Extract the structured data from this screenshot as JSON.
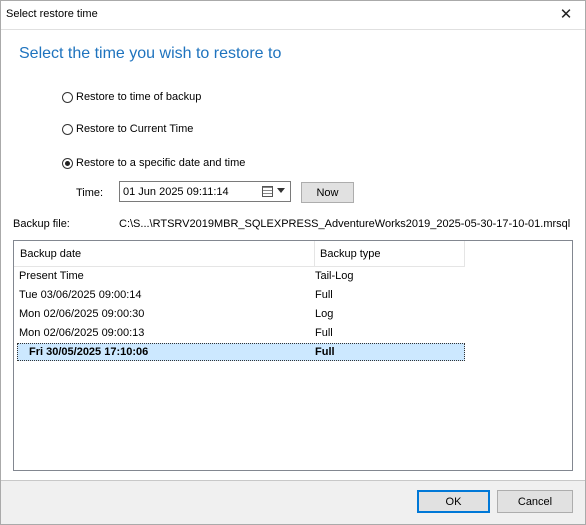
{
  "window": {
    "title": "Select restore time",
    "close_glyph": "✕"
  },
  "heading": "Select the time you wish to restore to",
  "options": [
    {
      "label": "Restore to time of backup",
      "checked": false
    },
    {
      "label": "Restore to Current Time",
      "checked": false
    },
    {
      "label": "Restore to a specific date and time",
      "checked": true
    }
  ],
  "time": {
    "label": "Time:",
    "value": "01 Jun  2025  09:11:14",
    "now_label": "Now"
  },
  "backup_file": {
    "label": "Backup file:",
    "value": "C:\\S...\\RTSRV2019MBR_SQLEXPRESS_AdventureWorks2019_2025-05-30-17-10-01.mrsql"
  },
  "grid": {
    "columns": [
      "Backup date",
      "Backup type"
    ],
    "rows": [
      {
        "date": "Present Time",
        "type": "Tail-Log",
        "selected": false
      },
      {
        "date": "Tue  03/06/2025 09:00:14",
        "type": "Full",
        "selected": false
      },
      {
        "date": "Mon  02/06/2025 09:00:30",
        "type": "Log",
        "selected": false
      },
      {
        "date": "Mon  02/06/2025 09:00:13",
        "type": "Full",
        "selected": false
      },
      {
        "date": "Fri  30/05/2025 17:10:06",
        "type": "Full",
        "selected": true
      }
    ]
  },
  "buttons": {
    "ok": "OK",
    "cancel": "Cancel"
  },
  "colors": {
    "heading": "#1e73be",
    "selection": "#cce8ff",
    "ok_border": "#0078d7"
  },
  "icons": {
    "close": "close-icon",
    "calendar": "calendar-icon",
    "dropdown": "chevron-down-icon"
  }
}
